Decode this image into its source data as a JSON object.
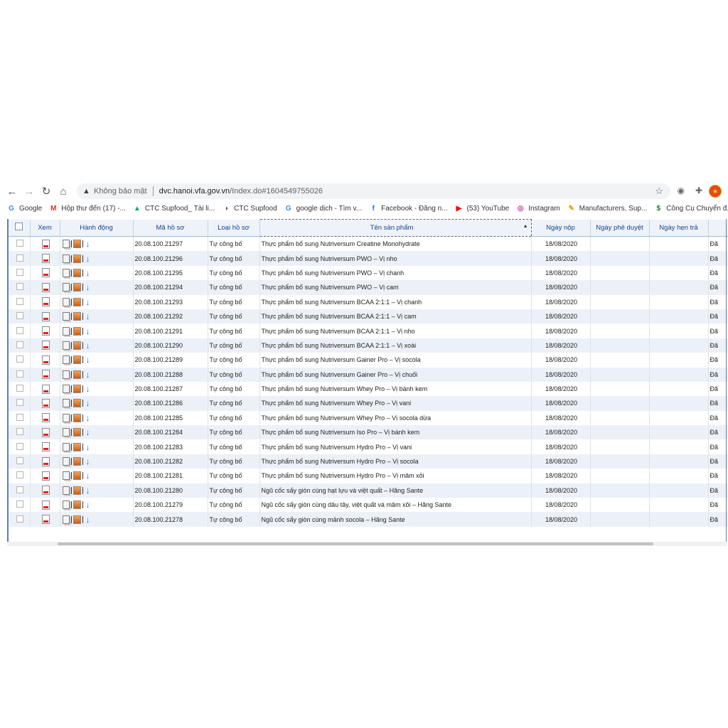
{
  "browser": {
    "insecure_label": "Không bảo mật",
    "url_host": "dvc.hanoi.vfa.gov.vn",
    "url_rest": "/Index.do#1604549755026"
  },
  "bookmarks": [
    {
      "icon": "google-icon",
      "label": "Google",
      "color": "#4285f4",
      "glyph": "G"
    },
    {
      "icon": "gmail-icon",
      "label": "Hộp thư đến (17) -...",
      "color": "#d93025",
      "glyph": "M"
    },
    {
      "icon": "drive-icon",
      "label": "CTC Supfood_ Tài li...",
      "color": "#1fa463",
      "glyph": "▲"
    },
    {
      "icon": "globe-icon",
      "label": "CTC Supfood",
      "color": "#555555",
      "glyph": "◑"
    },
    {
      "icon": "google-icon",
      "label": "google dịch - Tìm v...",
      "color": "#4285f4",
      "glyph": "G"
    },
    {
      "icon": "facebook-icon",
      "label": "Facebook - Đăng n...",
      "color": "#1877f2",
      "glyph": "f"
    },
    {
      "icon": "youtube-icon",
      "label": "(53) YouTube",
      "color": "#ff0000",
      "glyph": "▶"
    },
    {
      "icon": "instagram-icon",
      "label": "Instagram",
      "color": "#c13584",
      "glyph": "◎"
    },
    {
      "icon": "manufacturers-icon",
      "label": "Manufacturers, Sup...",
      "color": "#e8a100",
      "glyph": "✎"
    },
    {
      "icon": "dollar-icon",
      "label": "Công Cụ Chuyển đ...",
      "color": "#1e7b34",
      "glyph": "$"
    }
  ],
  "grid": {
    "columns": {
      "view": "Xem",
      "action": "Hành động",
      "code": "Mã hồ sơ",
      "type": "Loại hồ sơ",
      "product": "Tên sản phẩm",
      "submitted": "Ngày nộp",
      "approved": "Ngày phê duyệt",
      "due": "Ngày hẹn trả"
    },
    "rows": [
      {
        "code": "20.08.100.21297",
        "type": "Tự công bố",
        "product": "Thực phẩm bổ sung Nutriversum Creatine Monohydrate",
        "submitted": "18/08/2020",
        "status": "Đã"
      },
      {
        "code": "20.08.100.21296",
        "type": "Tự công bố",
        "product": "Thực phẩm bổ sung Nutriversum PWO – Vị nho",
        "submitted": "18/08/2020",
        "status": "Đã"
      },
      {
        "code": "20.08.100.21295",
        "type": "Tự công bố",
        "product": "Thực phẩm bổ sung Nutriversum PWO – Vị chanh",
        "submitted": "18/08/2020",
        "status": "Đã"
      },
      {
        "code": "20.08.100.21294",
        "type": "Tự công bố",
        "product": "Thực phẩm bổ sung Nutriversum PWO – Vị cam",
        "submitted": "18/08/2020",
        "status": "Đã"
      },
      {
        "code": "20.08.100.21293",
        "type": "Tự công bố",
        "product": "Thực phẩm bổ sung Nutriversum BCAA 2:1:1 – Vị chanh",
        "submitted": "18/08/2020",
        "status": "Đã"
      },
      {
        "code": "20.08.100.21292",
        "type": "Tự công bố",
        "product": "Thực phẩm bổ sung Nutriversum BCAA 2:1:1 – Vị cam",
        "submitted": "18/08/2020",
        "status": "Đã"
      },
      {
        "code": "20.08.100.21291",
        "type": "Tự công bố",
        "product": "Thực phẩm bổ sung Nutriversum BCAA 2:1:1 – Vị nho",
        "submitted": "18/08/2020",
        "status": "Đã"
      },
      {
        "code": "20.08.100.21290",
        "type": "Tự công bố",
        "product": "Thực phẩm bổ sung Nutriversum BCAA 2:1:1 – Vị xoài",
        "submitted": "18/08/2020",
        "status": "Đã"
      },
      {
        "code": "20.08.100.21289",
        "type": "Tự công bố",
        "product": "Thực phẩm bổ sung Nutriversum Gainer Pro – Vị socola",
        "submitted": "18/08/2020",
        "status": "Đã"
      },
      {
        "code": "20.08.100.21288",
        "type": "Tự công bố",
        "product": "Thực phẩm bổ sung Nutriversum Gainer Pro – Vị chuối",
        "submitted": "18/08/2020",
        "status": "Đã"
      },
      {
        "code": "20.08.100.21287",
        "type": "Tự công bố",
        "product": "Thực phẩm bổ sung Nutriversum Whey Pro – Vị bánh kem",
        "submitted": "18/08/2020",
        "status": "Đã"
      },
      {
        "code": "20.08.100.21286",
        "type": "Tự công bố",
        "product": "Thực phẩm bổ sung Nutriversum Whey Pro – Vị vani",
        "submitted": "18/08/2020",
        "status": "Đã"
      },
      {
        "code": "20.08.100.21285",
        "type": "Tự công bố",
        "product": "Thực phẩm bổ sung Nutriversum Whey Pro – Vị socola dừa",
        "submitted": "18/08/2020",
        "status": "Đã"
      },
      {
        "code": "20.08.100.21284",
        "type": "Tự công bố",
        "product": "Thực phẩm bổ sung Nutriversum Iso Pro – Vị bánh kem",
        "submitted": "18/08/2020",
        "status": "Đã"
      },
      {
        "code": "20.08.100.21283",
        "type": "Tự công bố",
        "product": "Thực phẩm bổ sung Nutriversum Hydro Pro – Vị vani",
        "submitted": "18/08/2020",
        "status": "Đã"
      },
      {
        "code": "20.08.100.21282",
        "type": "Tự công bố",
        "product": "Thực phẩm bổ sung Nutriversum Hydro Pro – Vị socola",
        "submitted": "18/08/2020",
        "status": "Đã"
      },
      {
        "code": "20.08.100.21281",
        "type": "Tự công bố",
        "product": "Thực phẩm bổ sung Nutriversum Hydro Pro – Vị mâm xôi",
        "submitted": "18/08/2020",
        "status": "Đã"
      },
      {
        "code": "20.08.100.21280",
        "type": "Tự công bố",
        "product": "Ngũ cốc sấy giòn cùng hạt lựu và việt quất – Hãng Sante",
        "submitted": "18/08/2020",
        "status": "Đã"
      },
      {
        "code": "20.08.100.21279",
        "type": "Tự công bố",
        "product": "Ngũ cốc sấy giòn cùng dâu tây, việt quất và mâm xôi – Hãng Sante",
        "submitted": "18/08/2020",
        "status": "Đã"
      },
      {
        "code": "20.08.100.21278",
        "type": "Tự công bố",
        "product": "Ngũ cốc sấy giòn cùng mảnh socola – Hãng Sante",
        "submitted": "18/08/2020",
        "status": "Đã"
      }
    ]
  }
}
